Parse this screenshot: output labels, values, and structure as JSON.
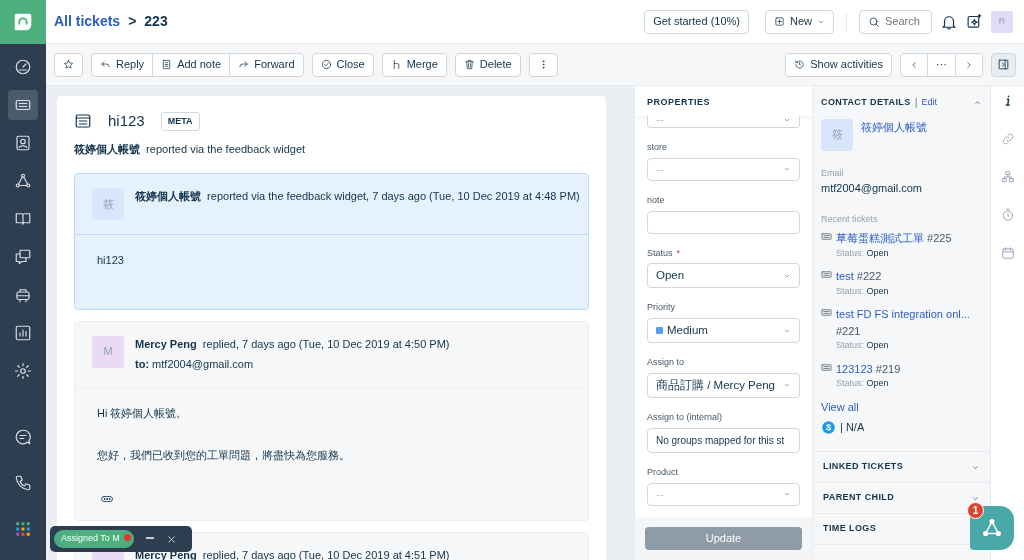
{
  "nav": {
    "items": [
      {
        "selected": false
      },
      {
        "selected": true
      },
      {
        "selected": false
      },
      {
        "selected": false
      },
      {
        "selected": false
      },
      {
        "selected": false
      },
      {
        "selected": false
      },
      {
        "selected": false
      },
      {
        "selected": false
      }
    ],
    "bottom_items": [
      {
        "selected": false
      },
      {
        "selected": false
      },
      {
        "selected": false
      }
    ]
  },
  "header": {
    "breadcrumb": "All tickets",
    "separator": ">",
    "ticket_id": "223",
    "get_started": "Get started (10%)",
    "new": "New",
    "search_placeholder": "Search",
    "avatar": "R"
  },
  "toolbar": {
    "actions": [
      {
        "label": "Reply"
      },
      {
        "label": "Add note"
      },
      {
        "label": "Forward"
      },
      {
        "label": "Close"
      },
      {
        "label": "Merge"
      },
      {
        "label": "Delete"
      }
    ],
    "show_activities": "Show activities",
    "pager_middle": "···"
  },
  "ticket": {
    "title": "hi123",
    "tag": "META",
    "reporter": "筱婷個人帳號",
    "reporter_note": "reported via the feedback widget"
  },
  "messages": [
    {
      "kind": "reported",
      "avatar": "筱",
      "author": "筱婷個人帳號",
      "meta": "reported via the feedback widget, 7 days ago (Tue, 10 Dec 2019 at 4:48 PM)",
      "body": [
        "hi123"
      ]
    },
    {
      "kind": "reply",
      "avatar": "M",
      "author": "Mercy Peng",
      "meta": "replied, 7 days ago (Tue, 10 Dec 2019 at 4:50 PM)",
      "to": "**to:** mtf2004@gmail.com",
      "body": [
        "Hi 筱婷個人帳號,",
        "您好，我們已收到您的工單問題，將盡快為您服務。"
      ],
      "quoted": true
    },
    {
      "kind": "reply",
      "author": "Mercy Peng",
      "meta": "replied, 7 days ago (Tue, 10 Dec 2019 at 4:51 PM)"
    }
  ],
  "toast": {
    "label": "Assigned To M"
  },
  "properties": {
    "title": "PROPERTIES",
    "fields": [
      {
        "kind": "select",
        "placeholder": "--"
      },
      {
        "kind": "select",
        "label": "store",
        "placeholder": "--"
      },
      {
        "kind": "text",
        "label": "note"
      },
      {
        "kind": "select",
        "label": "Status",
        "required_mark": "*",
        "value": "Open"
      },
      {
        "kind": "select",
        "label": "Priority",
        "value": "Medium",
        "color": "#5b9cf5"
      },
      {
        "kind": "select",
        "label": "Assign to",
        "value": "商品訂購 / Mercy Peng"
      },
      {
        "kind": "text",
        "label": "Assign to (internal)",
        "value": "No groups mapped for this st"
      },
      {
        "kind": "select",
        "label": "Product",
        "placeholder": "--"
      }
    ],
    "update": {
      "label": "Update",
      "disabled": true
    }
  },
  "contact": {
    "title": "CONTACT DETAILS",
    "separator": "|",
    "edit": "Edit",
    "expanded": true,
    "avatar": "筱",
    "name": "筱婷個人帳號",
    "email_label": "Email",
    "email": "mtf2004@gmail.com",
    "recent_label": "Recent tickets",
    "recent": [
      {
        "subject": "草莓蛋糕測試工單",
        "number": "#225",
        "status_label": "Status:",
        "status": "Open"
      },
      {
        "subject": "test",
        "number": "#222",
        "status_label": "Status:",
        "status": "Open"
      },
      {
        "subject": "test FD FS integration onl...",
        "number": "#221",
        "status_label": "Status:",
        "status": "Open"
      },
      {
        "subject": "123123",
        "number": "#219",
        "status_label": "Status:",
        "status": "Open"
      }
    ],
    "view_all": "View all",
    "skype": "| N/A"
  },
  "sections": [
    {
      "title": "LINKED TICKETS",
      "expanded": false
    },
    {
      "title": "PARENT CHILD",
      "expanded": false
    },
    {
      "title": "TIME LOGS"
    }
  ],
  "strip": [
    {
      "selected": true
    },
    {
      "selected": false
    },
    {
      "selected": false
    },
    {
      "selected": false
    },
    {
      "selected": false
    }
  ],
  "fab": {
    "badge": "1"
  }
}
